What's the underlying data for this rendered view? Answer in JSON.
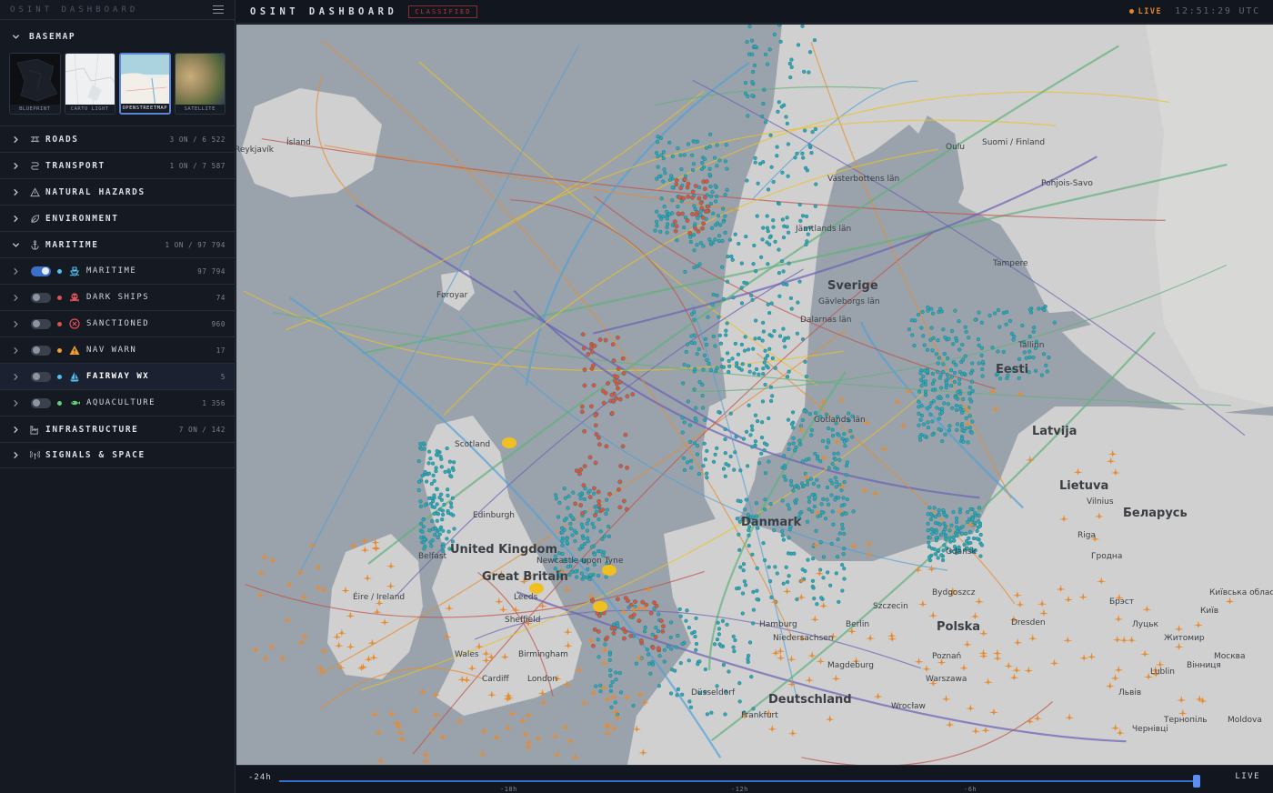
{
  "sidebar": {
    "title": "OSINT DASHBOARD",
    "basemap_label": "BASEMAP",
    "basemaps": [
      {
        "label": "BLUEPRINT",
        "selected": false
      },
      {
        "label": "CARTO LIGHT",
        "selected": false
      },
      {
        "label": "OPENSTREETMAP",
        "selected": true
      },
      {
        "label": "SATELLITE",
        "selected": false
      }
    ],
    "categories": [
      {
        "label": "ROADS",
        "count": "3 ON / 6 522",
        "icon": "road-icon",
        "expanded": false
      },
      {
        "label": "TRANSPORT",
        "count": "1 ON / 7 587",
        "icon": "route-icon",
        "expanded": false
      },
      {
        "label": "NATURAL HAZARDS",
        "count": "",
        "icon": "warning-triangle-icon",
        "expanded": false
      },
      {
        "label": "ENVIRONMENT",
        "count": "",
        "icon": "leaf-icon",
        "expanded": false
      },
      {
        "label": "MARITIME",
        "count": "1 ON / 97 794",
        "icon": "anchor-icon",
        "expanded": true
      }
    ],
    "maritime_layers": [
      {
        "label": "MARITIME",
        "count": "97 794",
        "on": true,
        "dot": "#4fc3f7",
        "icon": "ship-icon",
        "icon_color": "#4fc3f7"
      },
      {
        "label": "DARK SHIPS",
        "count": "74",
        "on": false,
        "dot": "#e05252",
        "icon": "skull-icon",
        "icon_color": "#e05252"
      },
      {
        "label": "SANCTIONED",
        "count": "960",
        "on": false,
        "dot": "#e05252",
        "icon": "x-circle-icon",
        "icon_color": "#e05252"
      },
      {
        "label": "NAV WARN",
        "count": "17",
        "on": false,
        "dot": "#f0a030",
        "icon": "warning-icon",
        "icon_color": "#f0a030"
      },
      {
        "label": "FAIRWAY WX",
        "count": "5",
        "on": false,
        "dot": "#4fc3f7",
        "icon": "sailboat-icon",
        "icon_color": "#4fc3f7"
      },
      {
        "label": "AQUACULTURE",
        "count": "1 356",
        "on": false,
        "dot": "#5fd07a",
        "icon": "fish-icon",
        "icon_color": "#5fd07a"
      }
    ],
    "bottom_categories": [
      {
        "label": "INFRASTRUCTURE",
        "count": "7 ON / 142",
        "icon": "factory-icon"
      },
      {
        "label": "SIGNALS & SPACE",
        "count": "",
        "icon": "antenna-icon"
      }
    ]
  },
  "topbar": {
    "title": "OSINT DASHBOARD",
    "badge": "CLASSIFIED",
    "live": "LIVE",
    "clock": "12:51:29 UTC"
  },
  "map": {
    "labels": [
      "Ísland",
      "Reykjavík",
      "Føroyar",
      "Sverige",
      "Suomi / Finland",
      "Oulu",
      "Tampere",
      "Eesti",
      "Tallinn",
      "Latvija",
      "Lietuva",
      "Vilnius",
      "Беларусь",
      "Danmark",
      "Deutschland",
      "Hamburg",
      "Berlin",
      "Polska",
      "Poznań",
      "Warszawa",
      "Wrocław",
      "Dresden",
      "Lublin",
      "United Kingdom",
      "Great Britain",
      "Leeds",
      "Sheffield",
      "Birmingham",
      "London",
      "Cardiff",
      "Wales",
      "Éire / Ireland",
      "Scotland",
      "Edinburgh",
      "Newcastle upon Tyne",
      "Belfast",
      "Gdańsk",
      "Szczecin",
      "Bydgoszcz",
      "Riga",
      "Gotlands län",
      "Jämtlands län",
      "Dalarnas län",
      "Västerbottens län",
      "Pohjois-Savo",
      "Gävleborgs län",
      "Magdeburg",
      "Niedersachsen",
      "Frankfurt",
      "Düsseldorf",
      "Москва",
      "Moldova",
      "Київ",
      "Львів",
      "Житомир",
      "Вінниця",
      "Луцьк",
      "Брэст",
      "Гродна",
      "Тернопіль",
      "Чернівці",
      "Київська область"
    ],
    "accent_colors": {
      "ship": "#2fa8b8",
      "aircraft": "#e88a2e",
      "sanctioned": "#e0553a",
      "track": "#f0c020"
    }
  },
  "timeline": {
    "start": "-24h",
    "end": "LIVE",
    "ticks": [
      "-18h",
      "-12h",
      "-6h"
    ]
  }
}
